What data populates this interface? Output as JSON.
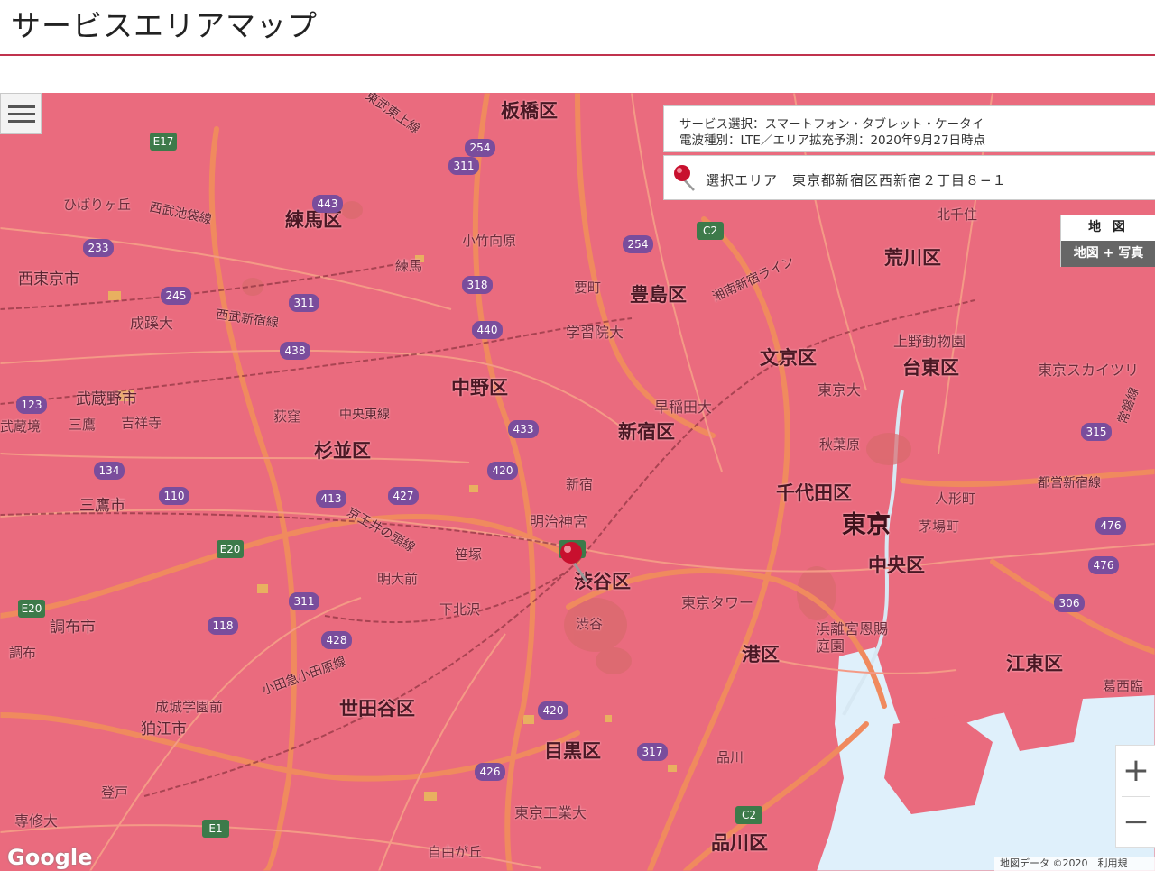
{
  "page": {
    "title": "サービスエリアマップ"
  },
  "info_panel": {
    "service_line": "サービス選択：スマートフォン・タブレット・ケータイ",
    "wave_line": "電波種別：LTE／エリア拡充予測：2020年9月27日時点"
  },
  "selected_area": {
    "label": "選択エリア",
    "address": "東京都新宿区西新宿２丁目８−１"
  },
  "map_type": {
    "map": "地 図",
    "satellite": "地図 + 写真"
  },
  "zoom": {
    "in": "+",
    "out": "−"
  },
  "attribution": {
    "logo": "Google",
    "text": "地図データ ©2020　利用規"
  },
  "colors": {
    "coverage": "#ea6b7e",
    "header_rule": "#c0334d",
    "water": "#dff0fb",
    "road": "#f08a5e"
  },
  "map_labels": {
    "wards": [
      "練馬区",
      "豊島区",
      "荒川区",
      "文京区",
      "台東区",
      "中野区",
      "新宿区",
      "杉並区",
      "千代田区",
      "渋谷区",
      "中央区",
      "港区",
      "江東区",
      "世田谷区",
      "目黒区",
      "品川区",
      "板橋区"
    ],
    "big_city": "東京",
    "cities": [
      "西東京市",
      "武蔵野市",
      "三鷹市",
      "調布市",
      "狛江市",
      "成蹊大",
      "早稲田大",
      "東京大",
      "明治神宮",
      "学習院大",
      "東京工業大",
      "専修大",
      "浜離宮恩賜庭園",
      "上野動物園",
      "東京スカイツリ",
      "東京タワー"
    ],
    "stations": [
      "ひばりヶ丘",
      "練馬",
      "小竹向原",
      "要町",
      "荻窪",
      "吉祥寺",
      "三鷹",
      "武蔵境",
      "新宿",
      "笹塚",
      "明大前",
      "下北沢",
      "渋谷",
      "秋葉原",
      "人形町",
      "茅場町",
      "北千住",
      "成城学園前",
      "登戸",
      "品川",
      "自由が丘",
      "調布",
      "葛西臨"
    ],
    "lines": [
      "西武池袋線",
      "西武新宿線",
      "中央東線",
      "京王井の頭線",
      "小田急小田原線",
      "湘南新宿ライン",
      "都営新宿線",
      "東武東上線",
      "常磐線"
    ]
  }
}
